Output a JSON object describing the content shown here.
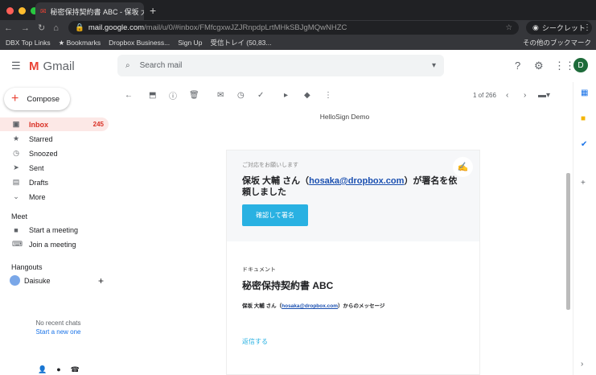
{
  "browser": {
    "tab_title": "秘密保持契約書 ABC - 保坂 大輔",
    "url_host": "mail.google.com",
    "url_path": "/mail/u/0/#inbox/FMfcgxwJZJRnpdpLrtMHkSBJgMQwNHZC",
    "profile": "シークレット",
    "bookmarks": [
      "DBX Top Links",
      "Bookmarks",
      "Dropbox Business...",
      "Sign Up",
      "受信トレイ (50,83..."
    ],
    "other_bookmarks": "その他のブックマーク"
  },
  "gmail": {
    "logo": "Gmail",
    "search_placeholder": "Search mail",
    "avatar": "D",
    "compose": "Compose",
    "nav": [
      {
        "label": "Inbox",
        "count": "245"
      },
      {
        "label": "Starred"
      },
      {
        "label": "Snoozed"
      },
      {
        "label": "Sent"
      },
      {
        "label": "Drafts"
      },
      {
        "label": "More"
      }
    ],
    "meet": {
      "title": "Meet",
      "items": [
        "Start a meeting",
        "Join a meeting"
      ]
    },
    "hangouts": {
      "title": "Hangouts",
      "user": "Daisuke",
      "no_chats": "No recent chats",
      "start_new": "Start a new one"
    },
    "pagination": "1 of 266"
  },
  "email": {
    "subject": "HelloSign Demo",
    "request_label": "ご対応をお願いします",
    "heading_pre": "保坂 大輔 さん（",
    "email": "hosaka@dropbox.com",
    "heading_post": "）が署名を依頼しました",
    "button": "確認して署名",
    "doc_label": "ドキュメント",
    "doc_title": "秘密保持契約書 ABC",
    "msg_pre": "保坂 大輔 さん（",
    "msg_post": "）からのメッセージ",
    "reply": "返信する"
  }
}
